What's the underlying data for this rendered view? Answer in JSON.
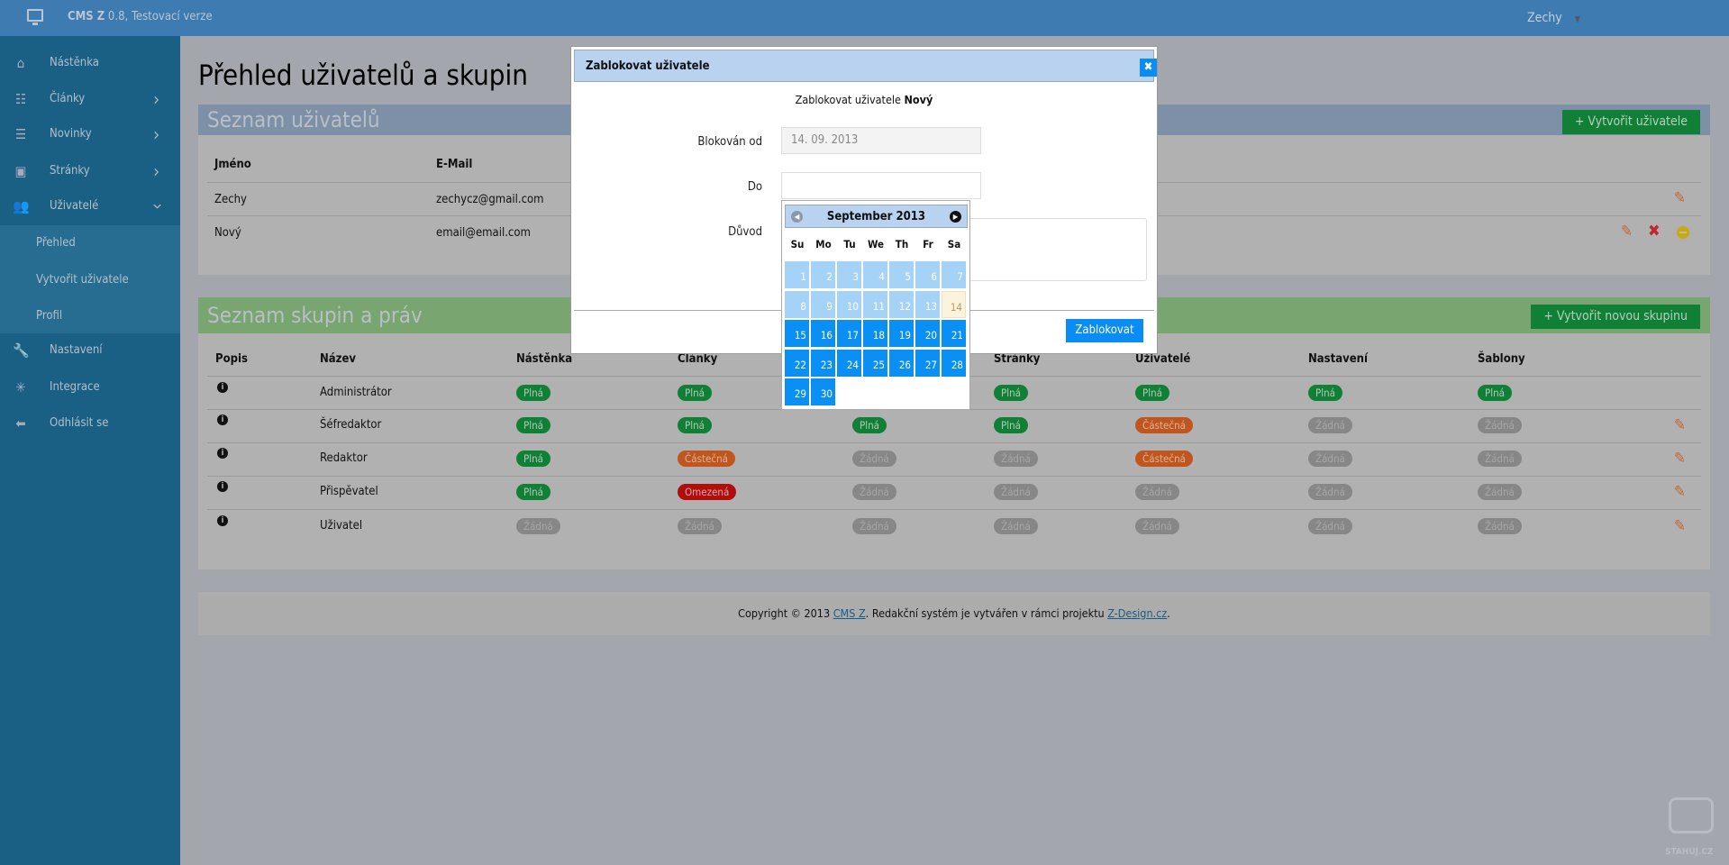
{
  "topbar": {
    "brand": "CMS Z",
    "version": "0.8, Testovací verze",
    "user": "Zechy",
    "icons": {
      "app": "monitor-icon",
      "user_menu": "caret-down-icon"
    }
  },
  "sidebar": {
    "items": [
      {
        "label": "Nástěnka",
        "icon": "home-icon"
      },
      {
        "label": "Články",
        "icon": "article-list-icon",
        "chevron": "right"
      },
      {
        "label": "Novinky",
        "icon": "list-icon",
        "chevron": "right"
      },
      {
        "label": "Stránky",
        "icon": "page-icon",
        "chevron": "right"
      },
      {
        "label": "Uživatelé",
        "icon": "users-icon",
        "chevron": "down"
      }
    ],
    "submenu": [
      "Přehled",
      "Vytvořit uživatele",
      "Profil"
    ],
    "items_after": [
      {
        "label": "Nastavení",
        "icon": "wrench-icon"
      },
      {
        "label": "Integrace",
        "icon": "integration-icon"
      },
      {
        "label": "Odhlásit se",
        "icon": "arrow-left-icon"
      }
    ]
  },
  "page": {
    "title": "Přehled uživatelů a skupin"
  },
  "users_panel": {
    "title": "Seznam uživatelů",
    "create_button": "Vytvořit uživatele",
    "columns": [
      "Jméno",
      "E-Mail"
    ],
    "rows": [
      {
        "name": "Zechy",
        "email": "zechycz@gmail.com",
        "actions": [
          "edit"
        ]
      },
      {
        "name": "Nový",
        "email": "email@email.com",
        "actions": [
          "edit",
          "delete",
          "block"
        ]
      }
    ]
  },
  "groups_panel": {
    "title": "Seznam skupin a práv",
    "create_button": "Vytvořit novou skupinu",
    "columns": [
      "Popis",
      "Název",
      "Nástěnka",
      "Články",
      "",
      "Stránky",
      "Uživatelé",
      "Nastavení",
      "Šablony"
    ],
    "rows": [
      {
        "name": "Administrátor",
        "perms": [
          "Plná",
          "Plná",
          "",
          "Plná",
          "Plná",
          "Plná",
          "Plná"
        ],
        "editable": false
      },
      {
        "name": "Šéfredaktor",
        "perms": [
          "Plná",
          "Plná",
          "Plná",
          "Plná",
          "Částečná",
          "Žádná",
          "Žádná"
        ],
        "editable": true
      },
      {
        "name": "Redaktor",
        "perms": [
          "Plná",
          "Částečná",
          "Žádná",
          "Žádná",
          "Částečná",
          "Žádná",
          "Žádná"
        ],
        "editable": true
      },
      {
        "name": "Přispěvatel",
        "perms": [
          "Plná",
          "Omezená",
          "Žádná",
          "Žádná",
          "Žádná",
          "Žádná",
          "Žádná"
        ],
        "editable": true
      },
      {
        "name": "Uživatel",
        "perms": [
          "Žádná",
          "Žádná",
          "Žádná",
          "Žádná",
          "Žádná",
          "Žádná",
          "Žádná"
        ],
        "editable": true
      }
    ],
    "badge_colors": {
      "Plná": "#0f8035",
      "Částečná": "#c0561e",
      "Omezená": "#b00d0d",
      "Žádná": "#878787"
    }
  },
  "footer": {
    "prefix": "Copyright © 2013 ",
    "link1": "CMS Z",
    "middle": ". Redakční systém je vytvářen v rámci projektu ",
    "link2": "Z-Design.cz",
    "suffix": "."
  },
  "modal": {
    "title": "Zablokovat uživatele",
    "message_prefix": "Zablokovat uživatele ",
    "message_user": "Nový",
    "from_label": "Blokován od",
    "from_value": "14. 09. 2013",
    "to_label": "Do",
    "to_value": "",
    "reason_label": "Důvod",
    "reason_value": "",
    "submit": "Zablokovat"
  },
  "datepicker": {
    "title": "September 2013",
    "weekdays": [
      "Su",
      "Mo",
      "Tu",
      "We",
      "Th",
      "Fr",
      "Sa"
    ],
    "first_weekday_index": 0,
    "days_in_month": 30,
    "today": 14
  },
  "colors": {
    "accent": "#0a8cf5",
    "topbar": "#3d7bb0",
    "sidebar": "#1a6085"
  },
  "watermark": "STAHUJ.CZ"
}
